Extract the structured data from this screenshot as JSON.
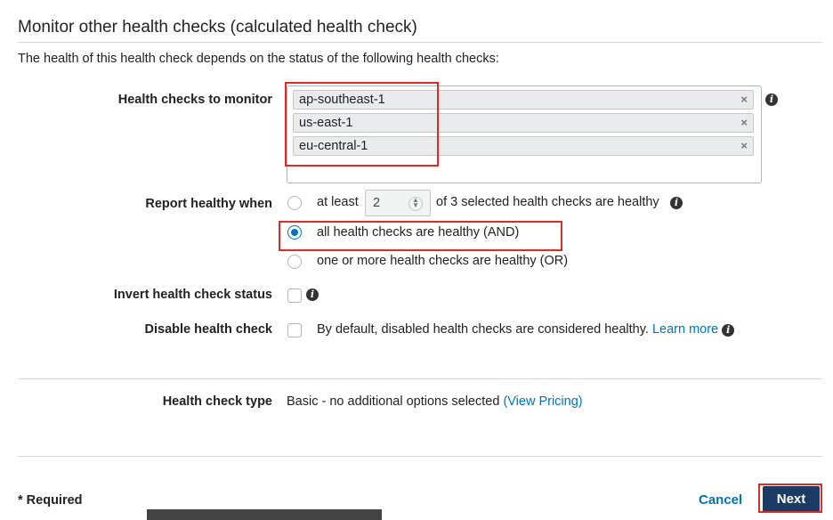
{
  "section": {
    "title": "Monitor other health checks (calculated health check)",
    "description": "The health of this health check depends on the status of the following health checks:"
  },
  "monitor": {
    "label": "Health checks to monitor",
    "tags": [
      "ap-southeast-1",
      "us-east-1",
      "eu-central-1"
    ],
    "remove_glyph": "×",
    "info_glyph": "i"
  },
  "report": {
    "label": "Report healthy when",
    "at_least_prefix": "at least",
    "at_least_value": "2",
    "at_least_suffix": "of 3 selected health checks are healthy",
    "all_label": "all health checks are healthy (AND)",
    "any_label": "one or more health checks are healthy (OR)",
    "selected": "all"
  },
  "invert": {
    "label": "Invert health check status",
    "checked": false
  },
  "disable": {
    "label": "Disable health check",
    "text": "By default, disabled health checks are considered healthy.",
    "link": "Learn more",
    "checked": false
  },
  "type": {
    "label": "Health check type",
    "value": "Basic - no additional options selected",
    "link": "(View Pricing)"
  },
  "footer": {
    "required": "* Required",
    "cancel": "Cancel",
    "next": "Next"
  },
  "colors": {
    "accent": "#0073bb",
    "primary_button": "#1b3d63",
    "highlight": "#e02a24"
  }
}
